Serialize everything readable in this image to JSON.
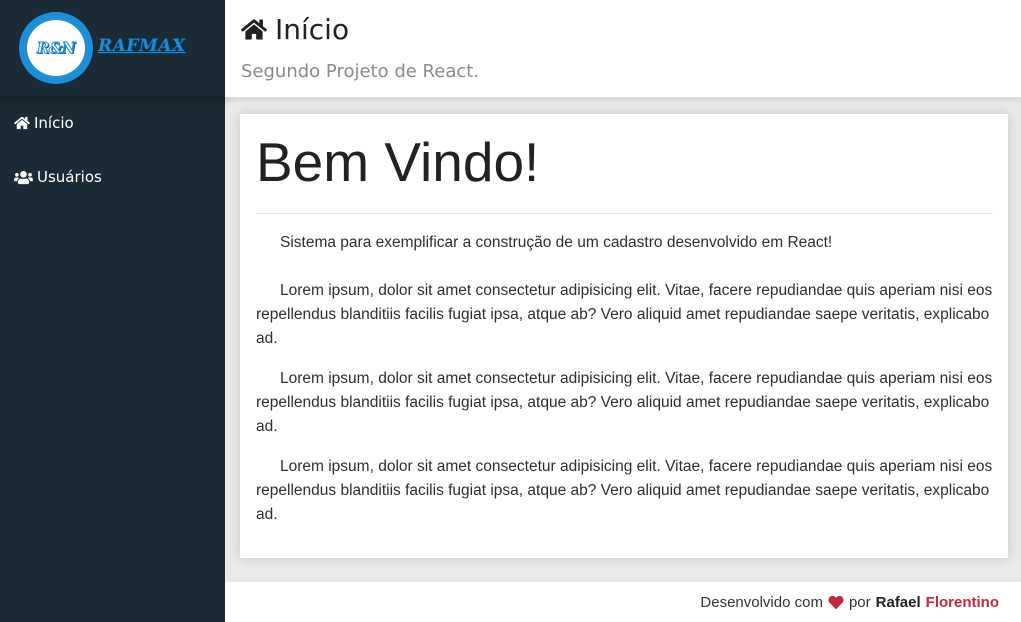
{
  "sidebar": {
    "logo_monogram": "R&N",
    "logo_wordmark": "RAFMAX",
    "items": [
      {
        "label": "Início",
        "icon": "home-icon"
      },
      {
        "label": "Usuários",
        "icon": "users-icon"
      }
    ]
  },
  "header": {
    "title": "Início",
    "title_icon": "home-icon",
    "subtitle": "Segundo Projeto de React."
  },
  "main": {
    "heading": "Bem Vindo!",
    "intro": "Sistema para exemplificar a construção de um cadastro desenvolvido em React!",
    "paragraphs": [
      "Lorem ipsum, dolor sit amet consectetur adipisicing elit. Vitae, facere repudiandae quis aperiam nisi eos repellendus blanditiis facilis fugiat ipsa, atque ab? Vero aliquid amet repudiandae saepe veritatis, explicabo ad.",
      "Lorem ipsum, dolor sit amet consectetur adipisicing elit. Vitae, facere repudiandae quis aperiam nisi eos repellendus blanditiis facilis fugiat ipsa, atque ab? Vero aliquid amet repudiandae saepe veritatis, explicabo ad.",
      "Lorem ipsum, dolor sit amet consectetur adipisicing elit. Vitae, facere repudiandae quis aperiam nisi eos repellendus blanditiis facilis fugiat ipsa, atque ab? Vero aliquid amet repudiandae saepe veritatis, explicabo ad."
    ]
  },
  "footer": {
    "prefix": "Desenvolvido com",
    "heart_icon": "heart-icon",
    "by": "por",
    "author_first": "Rafael",
    "author_last": "Florentino"
  },
  "colors": {
    "sidebar_bg": "#1a2b35",
    "accent_red": "#c5283d",
    "logo_blue": "#1e8ed8"
  }
}
